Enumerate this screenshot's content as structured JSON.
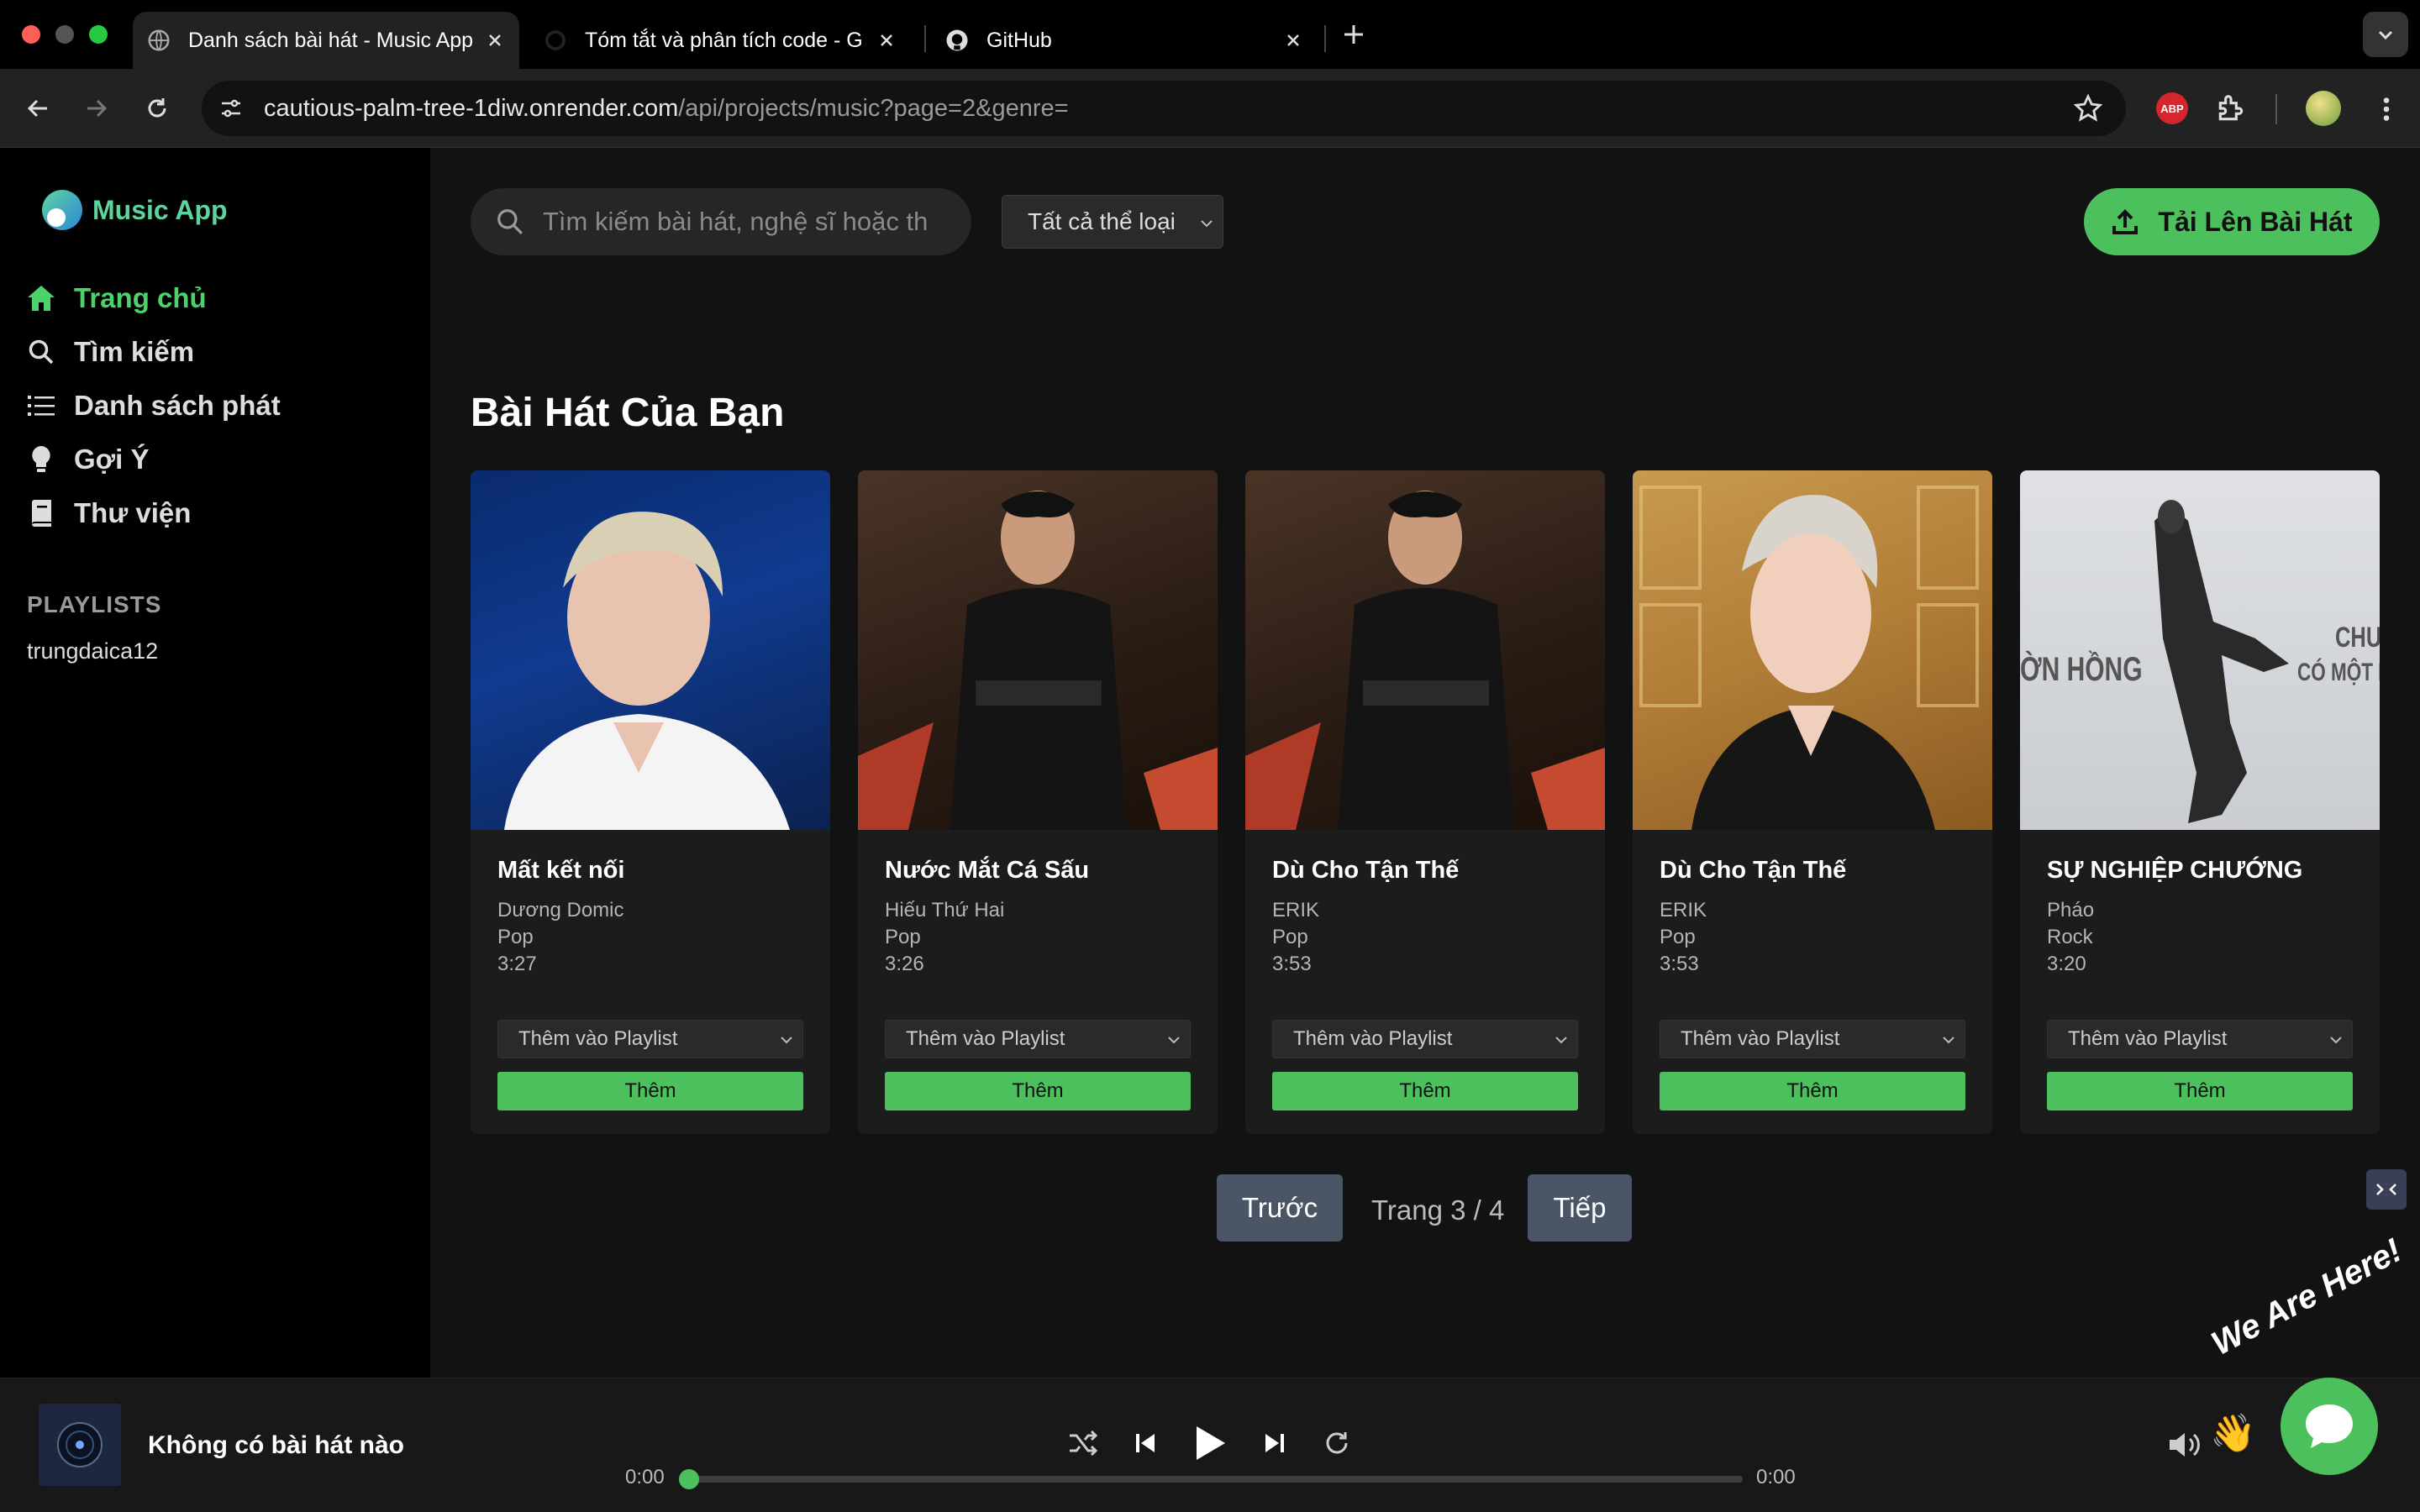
{
  "browser": {
    "tabs": [
      {
        "title": "Danh sách bài hát - Music App",
        "active": true
      },
      {
        "title": "Tóm tắt và phân tích code - G"
      },
      {
        "title": "GitHub"
      }
    ],
    "url_host": "cautious-palm-tree-1diw.onrender.com",
    "url_path": "/api/projects/music?page=2&genre=",
    "extension_badge": "ABP"
  },
  "sidebar": {
    "brand": "Music App",
    "items": [
      {
        "label": "Trang chủ",
        "icon": "home-icon",
        "active": true
      },
      {
        "label": "Tìm kiếm",
        "icon": "search-icon"
      },
      {
        "label": "Danh sách phát",
        "icon": "list-icon"
      },
      {
        "label": "Gợi Ý",
        "icon": "lightbulb-icon"
      },
      {
        "label": "Thư viện",
        "icon": "book-icon"
      }
    ],
    "playlists_heading": "PLAYLISTS",
    "playlists": [
      "trungdaica12"
    ]
  },
  "header": {
    "search_placeholder": "Tìm kiếm bài hát, nghệ sĩ hoặc th",
    "genre_selected": "Tất cả thể loại",
    "upload_label": "Tải Lên Bài Hát"
  },
  "section_title": "Bài Hát Của Bạn",
  "songs": [
    {
      "title": "Mất kết nối",
      "artist": "Dương Domic",
      "genre": "Pop",
      "duration": "3:27",
      "playlist_select": "Thêm vào Playlist",
      "add_label": "Thêm"
    },
    {
      "title": "Nước Mắt Cá Sấu",
      "artist": "Hiếu Thứ Hai",
      "genre": "Pop",
      "duration": "3:26",
      "playlist_select": "Thêm vào Playlist",
      "add_label": "Thêm"
    },
    {
      "title": "Dù Cho Tận Thế",
      "artist": "ERIK",
      "genre": "Pop",
      "duration": "3:53",
      "playlist_select": "Thêm vào Playlist",
      "add_label": "Thêm"
    },
    {
      "title": "Dù Cho Tận Thế",
      "artist": "ERIK",
      "genre": "Pop",
      "duration": "3:53",
      "playlist_select": "Thêm vào Playlist",
      "add_label": "Thêm"
    },
    {
      "title": "SỰ NGHIỆP CHƯỚNG",
      "artist": "Pháo",
      "genre": "Rock",
      "duration": "3:20",
      "playlist_select": "Thêm vào Playlist",
      "add_label": "Thêm",
      "art_text": [
        "ỜN HỒNG",
        "CHUYỆ",
        "CÓ MỘT NG"
      ]
    }
  ],
  "pagination": {
    "prev": "Trước",
    "status": "Trang 3 / 4",
    "next": "Tiếp"
  },
  "player": {
    "now_playing": "Không có bài hát nào",
    "time_current": "0:00",
    "time_total": "0:00",
    "progress": 0
  },
  "chat": {
    "label": "We Are Here!"
  },
  "colors": {
    "accent": "#4cc05d",
    "background": "#121212",
    "sidebar": "#000000"
  }
}
